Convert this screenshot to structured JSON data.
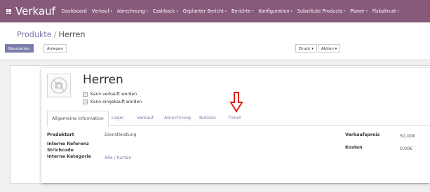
{
  "app": {
    "title": "Verkauf",
    "menu": [
      {
        "label": "Dashboard",
        "dropdown": false
      },
      {
        "label": "Verkauf",
        "dropdown": true
      },
      {
        "label": "Abrechnung",
        "dropdown": true
      },
      {
        "label": "Cashback",
        "dropdown": true
      },
      {
        "label": "Geplanter Bericht",
        "dropdown": true
      },
      {
        "label": "Berichte",
        "dropdown": true
      },
      {
        "label": "Konfiguration",
        "dropdown": true
      },
      {
        "label": "Substitute Products",
        "dropdown": true
      },
      {
        "label": "Planer",
        "dropdown": true
      },
      {
        "label": "Fiskaltrust",
        "dropdown": true
      }
    ],
    "caret": "▾"
  },
  "breadcrumb": {
    "parent": "Produkte",
    "separator": "/",
    "current": "Herren"
  },
  "buttons": {
    "edit": "Bearbeiten",
    "create": "Anlegen",
    "print": "Druck ▾",
    "action": "Aktion ▾"
  },
  "product": {
    "name": "Herren",
    "checkboxes": [
      {
        "label": "Kann verkauft werden",
        "checked": false
      },
      {
        "label": "Kann eingekauft werden",
        "checked": false
      }
    ]
  },
  "tabs": [
    {
      "label": "Allgemeine Information",
      "active": true
    },
    {
      "label": "Lager",
      "active": false
    },
    {
      "label": "Verkauf",
      "active": false
    },
    {
      "label": "Abrechnung",
      "active": false
    },
    {
      "label": "Notizen",
      "active": false
    },
    {
      "label": "Ticket",
      "active": false
    }
  ],
  "fields": {
    "produktart": {
      "label": "Produktart",
      "value": "Dienstleistung"
    },
    "interne_referenz": {
      "label": "Interne Referenz",
      "value": ""
    },
    "strichcode": {
      "label": "Strichcode",
      "value": ""
    },
    "interne_kategorie": {
      "label": "Interne Kategorie",
      "value": "Alle / Karten"
    },
    "verkaufspreis": {
      "label": "Verkaufspreis",
      "value": "50,00€"
    },
    "kosten": {
      "label": "Kosten",
      "value": "0,00€"
    }
  },
  "annotation": {
    "arrow_color": "#e0201b",
    "points_to": "Ticket"
  },
  "colors": {
    "navbar": "#875a7b",
    "accent": "#7c7bad"
  }
}
